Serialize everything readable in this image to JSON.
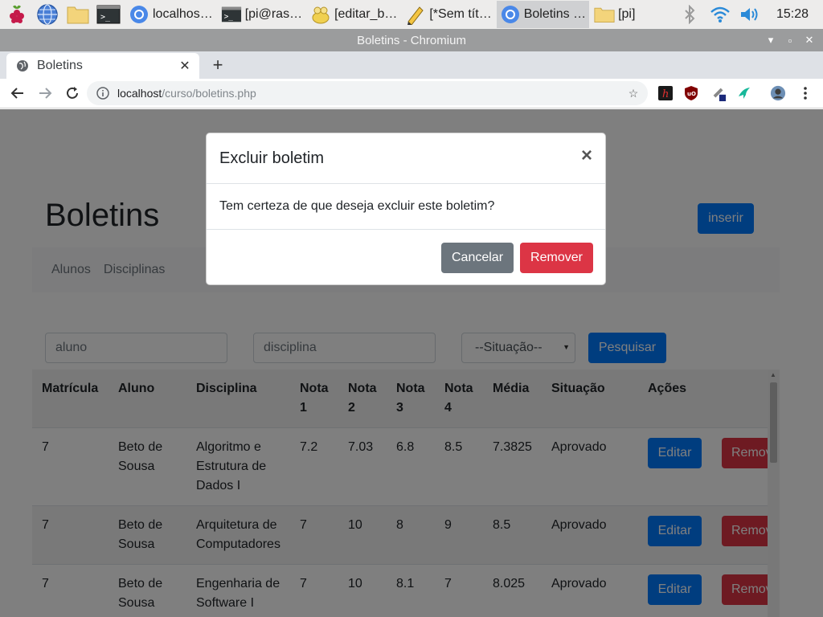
{
  "taskbar": {
    "tasks": [
      {
        "label": "localhos…",
        "icon": "chromium-icon"
      },
      {
        "label": "[pi@ras…",
        "icon": "terminal-icon"
      },
      {
        "label": "[editar_b…",
        "icon": "geany-icon"
      },
      {
        "label": "[*Sem tít…",
        "icon": "text-editor-icon"
      },
      {
        "label": "Boletins …",
        "icon": "chromium-icon"
      },
      {
        "label": "[pi]",
        "icon": "folder-icon"
      }
    ],
    "clock": "15:28"
  },
  "window": {
    "title": "Boletins - Chromium"
  },
  "browser": {
    "tab_title": "Boletins",
    "url_host": "localhost",
    "url_path": "/curso/boletins.php"
  },
  "page": {
    "title": "Boletins",
    "insert_label": "inserir",
    "nav": [
      "Alunos",
      "Disciplinas"
    ],
    "filters": {
      "aluno_placeholder": "aluno",
      "disciplina_placeholder": "disciplina",
      "situacao_selected": "--Situação--",
      "search_label": "Pesquisar"
    },
    "table": {
      "headers": [
        "Matrícula",
        "Aluno",
        "Disciplina",
        "Nota 1",
        "Nota 2",
        "Nota 3",
        "Nota 4",
        "Média",
        "Situação",
        "Ações"
      ],
      "header_display": [
        [
          "Matrícula"
        ],
        [
          "Aluno"
        ],
        [
          "Disciplina"
        ],
        [
          "Nota",
          "1"
        ],
        [
          "Nota",
          "2"
        ],
        [
          "Nota",
          "3"
        ],
        [
          "Nota",
          "4"
        ],
        [
          "Média"
        ],
        [
          "Situação"
        ],
        [
          "Ações"
        ]
      ],
      "rows": [
        {
          "matricula": "7",
          "aluno": "Beto de Sousa",
          "disciplina": "Algoritmo e Estrutura de Dados I",
          "n1": "7.2",
          "n2": "7.03",
          "n3": "6.8",
          "n4": "8.5",
          "media": "7.3825",
          "situacao": "Aprovado"
        },
        {
          "matricula": "7",
          "aluno": "Beto de Sousa",
          "disciplina": "Arquitetura de Computadores",
          "n1": "7",
          "n2": "10",
          "n3": "8",
          "n4": "9",
          "media": "8.5",
          "situacao": "Aprovado"
        },
        {
          "matricula": "7",
          "aluno": "Beto de Sousa",
          "disciplina": "Engenharia de Software I",
          "n1": "7",
          "n2": "10",
          "n3": "8.1",
          "n4": "7",
          "media": "8.025",
          "situacao": "Aprovado"
        }
      ],
      "edit_label": "Editar",
      "remove_label": "Remover"
    }
  },
  "modal": {
    "title": "Excluir boletim",
    "close_label": "×",
    "message": "Tem certeza de que deseja excluir este boletim?",
    "cancel_label": "Cancelar",
    "confirm_label": "Remover"
  },
  "colors": {
    "primary": "#007bff",
    "danger": "#dc3545",
    "secondary": "#6c757d"
  }
}
